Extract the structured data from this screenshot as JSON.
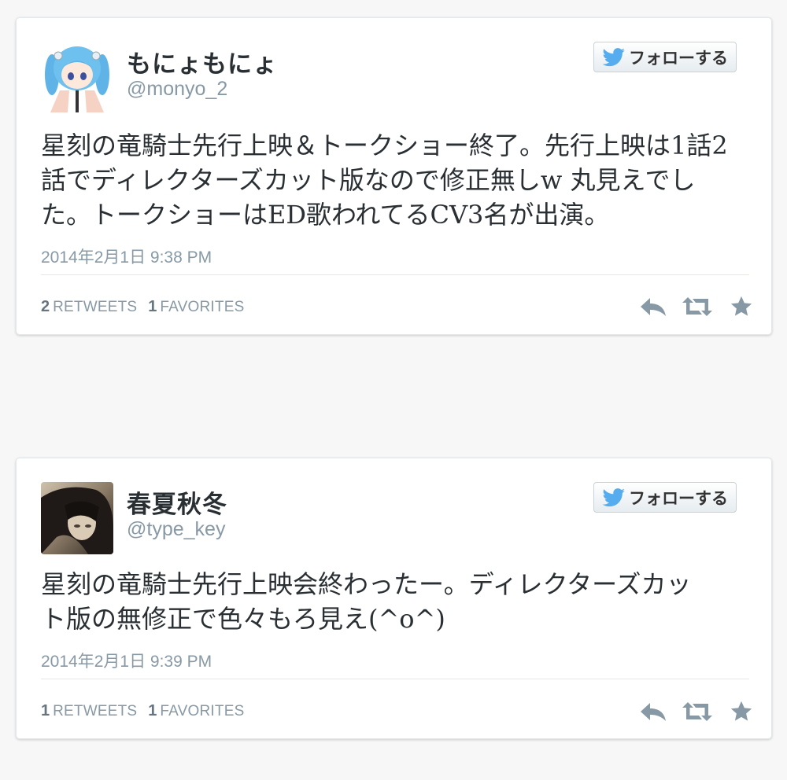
{
  "colors": {
    "text": "#292f33",
    "muted": "#8899a6",
    "twitter_blue": "#55acee",
    "icon_gray": "#8899a6"
  },
  "tweets": [
    {
      "display_name": "もにょもにょ",
      "screen_name": "@monyo_2",
      "follow_label": "フォローする",
      "text": "星刻の竜騎士先行上映＆トークショー終了。先行上映は1話2話でディレクターズカット版なので修正無しw 丸見えでした。トークショーはED歌われてるCV3名が出演。",
      "timestamp": "2014年2月1日 9:38 PM",
      "retweets_count": "2",
      "retweets_label": "RETWEETS",
      "favorites_count": "1",
      "favorites_label": "FAVORITES",
      "icons": [
        "reply-icon",
        "retweet-icon",
        "favorite-star-icon"
      ]
    },
    {
      "display_name": "春夏秋冬",
      "screen_name": "@type_key",
      "follow_label": "フォローする",
      "text": "星刻の竜騎士先行上映会終わったー。ディレクターズカット版の無修正で色々もろ見え(^o^)",
      "timestamp": "2014年2月1日 9:39 PM",
      "retweets_count": "1",
      "retweets_label": "RETWEETS",
      "favorites_count": "1",
      "favorites_label": "FAVORITES",
      "icons": [
        "reply-icon",
        "retweet-icon",
        "favorite-star-icon"
      ]
    }
  ]
}
